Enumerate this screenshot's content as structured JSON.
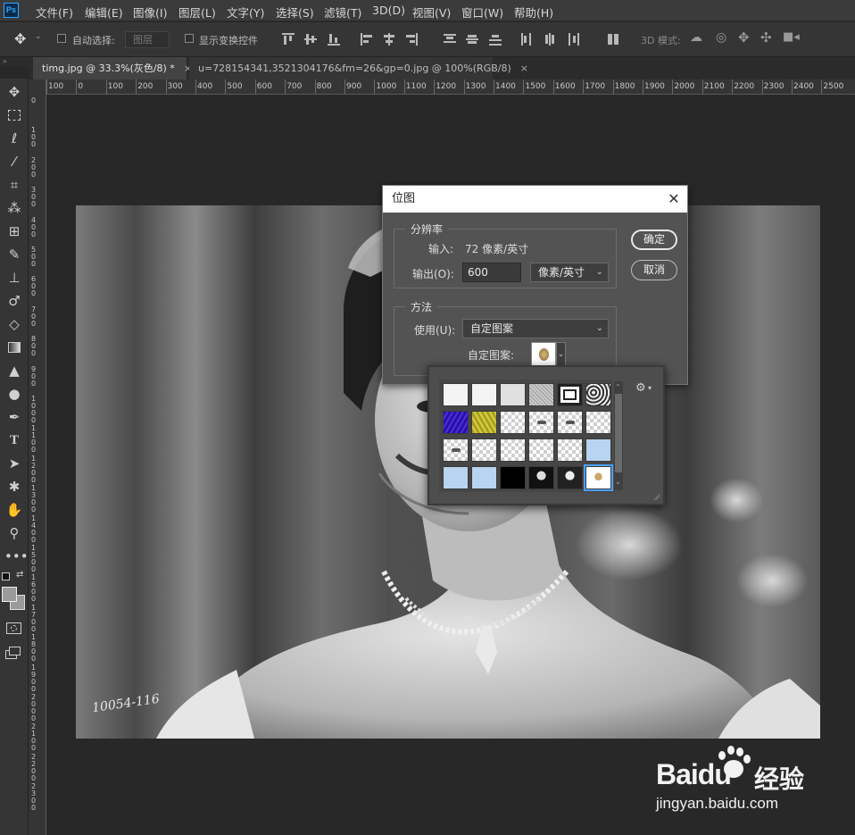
{
  "app": {
    "logo_text": "Ps"
  },
  "menu": [
    "文件(F)",
    "编辑(E)",
    "图像(I)",
    "图层(L)",
    "文字(Y)",
    "选择(S)",
    "滤镜(T)",
    "3D(D)",
    "视图(V)",
    "窗口(W)",
    "帮助(H)"
  ],
  "options_bar": {
    "auto_select_label": "自动选择:",
    "auto_select_value": "图层",
    "show_transform_label": "显示变换控件",
    "mode_3d_label": "3D 模式:"
  },
  "tabs": [
    {
      "label": "timg.jpg @ 33.3%(灰色/8) *",
      "close": "×"
    },
    {
      "label": "u=728154341,3521304176&fm=26&gp=0.jpg @ 100%(RGB/8)",
      "close": "×"
    }
  ],
  "ruler": {
    "h_labels": [
      "100",
      "0",
      "100",
      "200",
      "300",
      "400",
      "500",
      "600",
      "700",
      "800",
      "900",
      "1000",
      "1100",
      "1200",
      "1300",
      "1400",
      "1500",
      "1600",
      "1700",
      "1800",
      "1900",
      "2000",
      "2100",
      "2200",
      "2300",
      "2400",
      "2500"
    ],
    "v_labels": [
      "0",
      "100",
      "200",
      "300",
      "400",
      "500",
      "600",
      "700",
      "800",
      "900",
      "1000",
      "1100",
      "1200",
      "1300",
      "1400",
      "1500",
      "1600",
      "1700",
      "1800",
      "1900",
      "2000",
      "2100",
      "2200",
      "2300"
    ]
  },
  "photo": {
    "caption": "10054-116"
  },
  "dialog": {
    "title": "位图",
    "close": "✕",
    "resolution": {
      "legend": "分辨率",
      "input_label": "输入:",
      "input_value": "72 像素/英寸",
      "output_label": "输出(O):",
      "output_value": "600",
      "unit": "像素/英寸"
    },
    "method": {
      "legend": "方法",
      "use_label": "使用(U):",
      "use_value": "自定图案",
      "pattern_label": "自定图案:"
    },
    "ok": "确定",
    "cancel": "取消"
  },
  "pattern_picker": {
    "gear": "⚙",
    "rows": [
      [
        "paper-white",
        "paper-white",
        "paper-grey",
        "noise",
        "square-frame",
        "rock-texture"
      ],
      [
        "blue-texture",
        "yellow-texture",
        "transparent",
        "transparent-mark",
        "transparent-mark",
        "transparent"
      ],
      [
        "transparent-mark",
        "transparent",
        "transparent",
        "transparent",
        "transparent",
        "light-blue"
      ],
      [
        "light-blue",
        "light-blue",
        "black",
        "portrait-a",
        "portrait-b",
        "portrait-selected"
      ]
    ]
  },
  "watermark": {
    "brand": "Baidu",
    "cn": "经验",
    "url": "jingyan.baidu.com"
  }
}
